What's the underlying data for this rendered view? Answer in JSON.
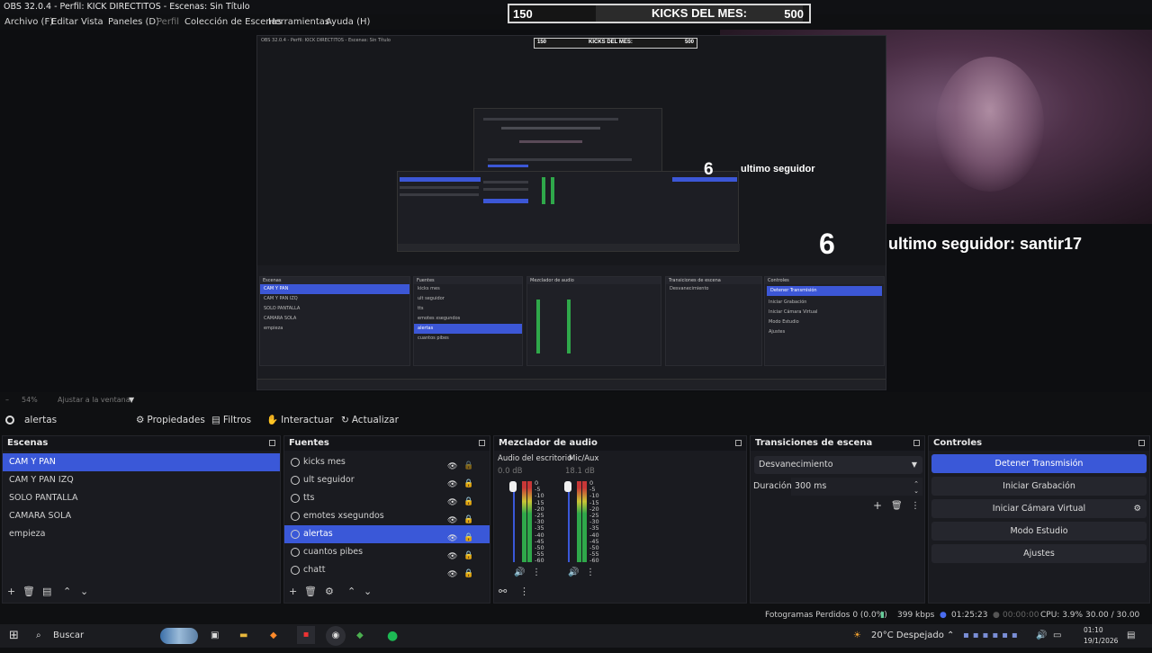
{
  "window": {
    "title": "OBS 32.0.4 - Perfil: KICK DIRECTITOS - Escenas: Sin Título"
  },
  "menu": {
    "items": [
      "Archivo (F)",
      "Editar",
      "Vista",
      "Paneles (D)",
      "Perfil",
      "Colección de Escenas",
      "Herramientas",
      "Ayuda (H)"
    ]
  },
  "overlay": {
    "kicks": {
      "current": "150",
      "label": "KICKS DEL MES:",
      "goal": "500"
    },
    "follower": {
      "count": "6",
      "label": "ultimo seguidor",
      "full": "ultimo seguidor: santir17"
    }
  },
  "zoom": {
    "value": "54%",
    "fit": "Ajustar a la ventana"
  },
  "source_toolbar": {
    "selected_source": "alertas",
    "properties": "Propiedades",
    "filters": "Filtros",
    "interact": "Interactuar",
    "refresh": "Actualizar"
  },
  "scenes": {
    "title": "Escenas",
    "items": [
      "CAM Y PAN",
      "CAM Y PAN IZQ",
      "SOLO PANTALLA",
      "CAMARA SOLA",
      "empieza"
    ],
    "selected_index": 0
  },
  "sources": {
    "title": "Fuentes",
    "items": [
      "kicks mes",
      "ult seguidor",
      "tts",
      "emotes xsegundos",
      "alertas",
      "cuantos pibes",
      "chatt"
    ],
    "selected_index": 4
  },
  "mixer": {
    "title": "Mezclador de audio",
    "channels": [
      {
        "name": "Audio del escritorio",
        "db": "0.0 dB"
      },
      {
        "name": "Mic/Aux",
        "db": "18.1 dB"
      }
    ],
    "ticks": [
      "0",
      "-5",
      "-10",
      "-15",
      "-20",
      "-25",
      "-30",
      "-35",
      "-40",
      "-45",
      "-50",
      "-55",
      "-60"
    ]
  },
  "transitions": {
    "title": "Transiciones de escena",
    "selected": "Desvanecimiento",
    "duration_label": "Duración",
    "duration_value": "300 ms"
  },
  "controls": {
    "title": "Controles",
    "buttons": [
      "Detener Transmisión",
      "Iniciar Grabación",
      "Iniciar Cámara Virtual",
      "Modo Estudio",
      "Ajustes"
    ]
  },
  "status": {
    "dropped": "Fotogramas Perdidos 0 (0.0%)",
    "bitrate": "399 kbps",
    "live_time": "01:25:23",
    "rec_time": "00:00:00",
    "cpu": "CPU: 3.9%",
    "fps": "30.00 / 30.00 FPS"
  },
  "taskbar": {
    "search": "Buscar",
    "weather": "20°C  Despejado",
    "time": "01:10",
    "date": "19/1/2026"
  },
  "colors": {
    "accent": "#3a58d8",
    "panel": "#1a1b20",
    "background": "#0f1012"
  }
}
